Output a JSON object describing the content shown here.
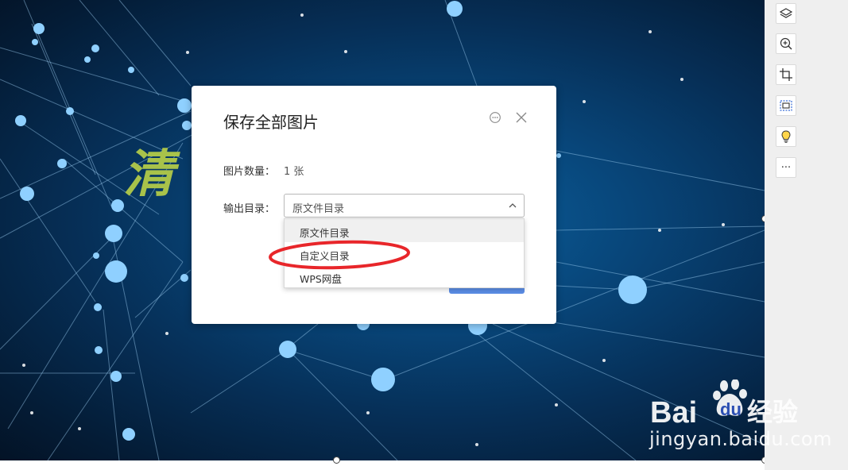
{
  "slide": {
    "title_text": "清"
  },
  "dialog": {
    "title": "保存全部图片",
    "count_label": "图片数量：",
    "count_value": "1 张",
    "output_label": "输出目录：",
    "output_selected": "原文件目录",
    "options": [
      "原文件目录",
      "自定义目录",
      "WPS网盘"
    ]
  },
  "toolbar": {
    "tools": [
      "layers-icon",
      "zoom-in-icon",
      "crop-icon",
      "image-select-icon",
      "lightbulb-icon",
      "more-icon"
    ],
    "more_label": "···"
  },
  "watermark": {
    "logo_text_bai": "Bai",
    "logo_text_du": "du",
    "logo_text_cn": "经验",
    "url": "jingyan.baidu.com"
  },
  "colors": {
    "annotation_red": "#e8262a",
    "accent_blue": "#5b8de6",
    "slide_title": "#a8c24a"
  }
}
